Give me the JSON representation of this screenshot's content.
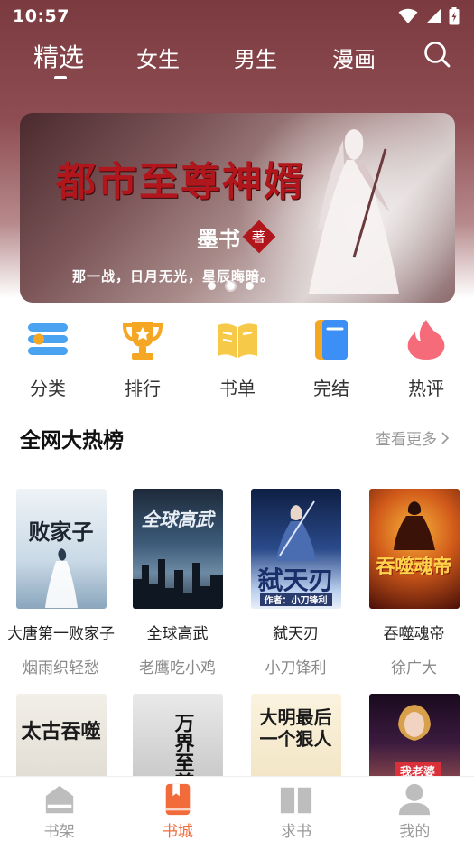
{
  "status_bar": {
    "time": "10:57"
  },
  "tabs": [
    {
      "label": "精选",
      "active": true
    },
    {
      "label": "女生",
      "active": false
    },
    {
      "label": "男生",
      "active": false
    },
    {
      "label": "漫画",
      "active": false
    }
  ],
  "banner": {
    "title": "都市至尊神婿",
    "author": "墨书",
    "seal": "著",
    "tagline": "那一战，日月无光，星辰晦暗。",
    "page_count": 3,
    "active_page": 1
  },
  "quick_links": [
    {
      "label": "分类",
      "icon": "category-icon",
      "color": "#4aa3f0"
    },
    {
      "label": "排行",
      "icon": "trophy-icon",
      "color": "#f5a623"
    },
    {
      "label": "书单",
      "icon": "open-book-icon",
      "color": "#f7c948"
    },
    {
      "label": "完结",
      "icon": "finished-book-icon",
      "color": "#3b8ff5"
    },
    {
      "label": "热评",
      "icon": "flame-icon",
      "color": "#f56b7a"
    }
  ],
  "section": {
    "title": "全网大热榜",
    "more": "查看更多"
  },
  "books": [
    {
      "title": "大唐第一败家子",
      "author": "烟雨织轻愁",
      "cover_text": "败家子"
    },
    {
      "title": "全球高武",
      "author": "老鹰吃小鸡",
      "cover_text": "全球高武"
    },
    {
      "title": "弑天刃",
      "author": "小刀锋利",
      "cover_text": "弑天刃",
      "cover_byline": "作者：小刀锋利"
    },
    {
      "title": "吞噬魂帝",
      "author": "徐广大",
      "cover_text": "吞噬魂帝"
    },
    {
      "title": "",
      "author": "",
      "cover_text": "太古吞噬"
    },
    {
      "title": "",
      "author": "",
      "cover_text": "万界至尊"
    },
    {
      "title": "",
      "author": "",
      "cover_text": "大明最后一个狠人"
    },
    {
      "title": "",
      "author": "",
      "cover_text": "我老婆"
    }
  ],
  "bottom_nav": [
    {
      "label": "书架",
      "icon": "bookshelf-icon",
      "active": false
    },
    {
      "label": "书城",
      "icon": "bookstore-icon",
      "active": true
    },
    {
      "label": "求书",
      "icon": "request-book-icon",
      "active": false
    },
    {
      "label": "我的",
      "icon": "profile-icon",
      "active": false
    }
  ],
  "colors": {
    "accent": "#f26b3a",
    "header_bg": "#7a3a3f"
  }
}
